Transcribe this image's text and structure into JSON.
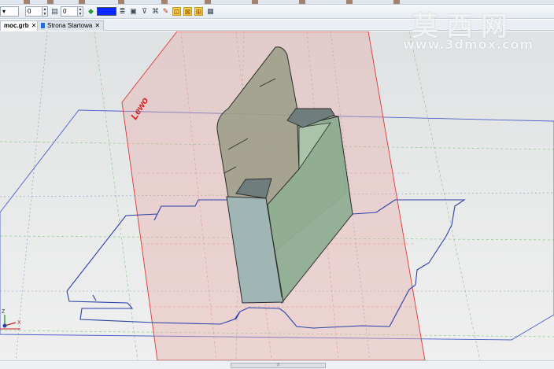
{
  "toolbar": {
    "field1_value": "0",
    "field2_value": "0",
    "layer_color": "#0a28ff",
    "icons": [
      "layer-icon",
      "color-picker-icon",
      "list-icon",
      "window-icon",
      "filter-icon",
      "tree-icon",
      "tools-icon",
      "select-highlight-icon",
      "snap-icon-a",
      "snap-icon-b"
    ]
  },
  "tabs": [
    {
      "label": "moc.grb",
      "close": "✕",
      "active": true
    },
    {
      "label": "Strona Startowa",
      "close": "✕",
      "active": false
    }
  ],
  "viewport": {
    "plane_label": "Lewo",
    "axis_z": "Z",
    "axis_x": "X",
    "colors": {
      "plane_fill": "#e7a7a6",
      "plane_edge": "#d93a3a",
      "plane_label": "#d62020",
      "outline": "#2a3fa8",
      "box_front": "#9fb6b4",
      "box_side": "#8fae92",
      "box_back": "#9a9c86",
      "grid": "#7fbf7f"
    }
  },
  "scrollbar": {
    "thumb_grip": "⦙⦙⦙"
  },
  "watermark": {
    "chinese": "莫西网",
    "url": "www.3dmox.com"
  }
}
